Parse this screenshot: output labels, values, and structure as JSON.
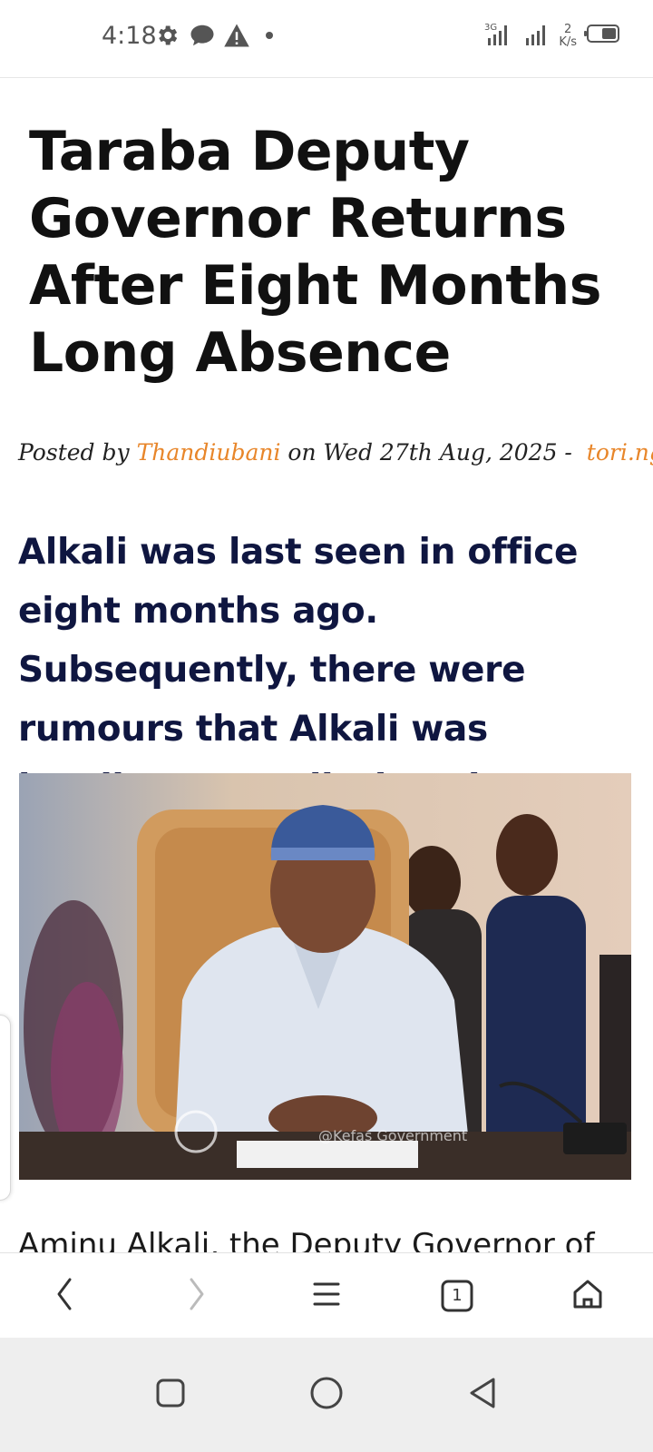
{
  "status_bar": {
    "time": "4:18",
    "icons": [
      "gear-icon",
      "chat-bubble-icon",
      "warning-icon",
      "dot-icon"
    ],
    "network_label": "3G",
    "net_speed_value": "2",
    "net_speed_unit": "K/s"
  },
  "article": {
    "title": "Taraba Deputy Governor Returns After Eight Months Long Absence",
    "byline": {
      "prefix": "Posted by",
      "author": "Thandiubani",
      "middle": "on Wed 27th Aug, 2025 -",
      "source": "tori.ng"
    },
    "lede": "Alkali was last seen in office eight months ago. Subsequently, there were rumours that Alkali was battling an undisclosed ailment.",
    "photo_watermark": "@Kefas Government",
    "body_start": "Aminu Alkali, the Deputy Governor of"
  },
  "browser_toolbar": {
    "tab_count": "1",
    "icons": [
      "back-icon",
      "forward-icon",
      "menu-icon",
      "tabs-icon",
      "home-icon"
    ]
  },
  "system_nav": {
    "icons": [
      "recents-icon",
      "home-circle-icon",
      "back-triangle-icon"
    ]
  },
  "colors": {
    "accent": "#e8862a",
    "lede": "#0f1640",
    "title": "#111111"
  }
}
